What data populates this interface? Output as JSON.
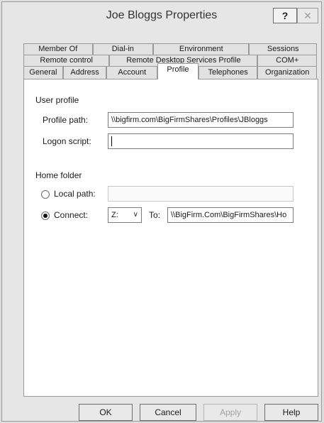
{
  "window": {
    "title": "Joe Bloggs Properties",
    "help_glyph": "?",
    "close_glyph": "✕"
  },
  "tabs": {
    "row1": [
      "Member Of",
      "Dial-in",
      "Environment",
      "Sessions"
    ],
    "row2": [
      "Remote control",
      "Remote Desktop Services Profile",
      "COM+"
    ],
    "row3": [
      "General",
      "Address",
      "Account",
      "Profile",
      "Telephones",
      "Organization"
    ],
    "active": "Profile"
  },
  "user_profile": {
    "section_label": "User profile",
    "profile_path_label": "Profile path:",
    "profile_path_value": "\\\\bigfirm.com\\BigFirmShares\\Profiles\\JBloggs",
    "logon_script_label": "Logon script:",
    "logon_script_value": ""
  },
  "home_folder": {
    "section_label": "Home folder",
    "local_path_label": "Local path:",
    "local_path_value": "",
    "connect_label": "Connect:",
    "drive_value": "Z:",
    "to_label": "To:",
    "to_value": "\\\\BigFirm.Com\\BigFirmShares\\Ho",
    "selected": "connect"
  },
  "buttons": {
    "ok": "OK",
    "cancel": "Cancel",
    "apply": "Apply",
    "help": "Help"
  }
}
